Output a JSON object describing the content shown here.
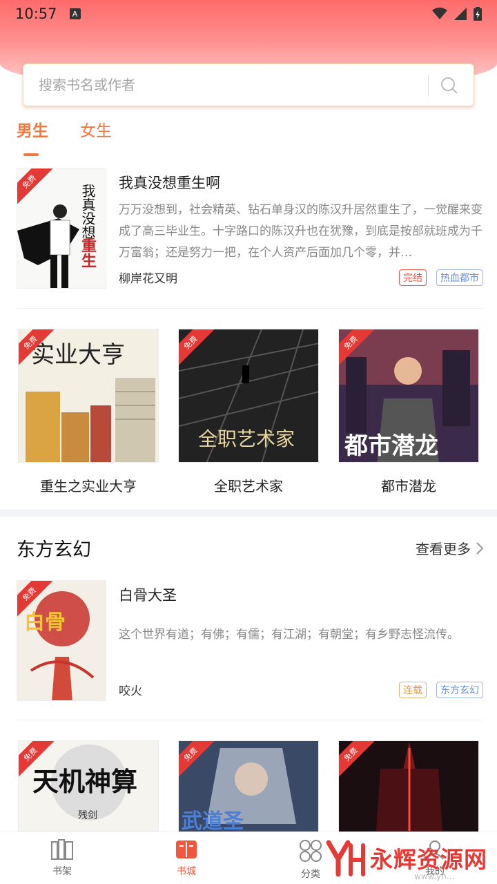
{
  "status": {
    "time": "10:57",
    "notif": "A"
  },
  "search": {
    "placeholder": "搜索书名或作者"
  },
  "gender_tabs": [
    {
      "label": "男生"
    },
    {
      "label": "女生"
    }
  ],
  "ribbon_label": "免费",
  "featured_1": {
    "title": "我真没想重生啊",
    "desc": "万万没想到，社会精英、钻石单身汉的陈汉升居然重生了，一觉醒来变成了高三毕业生。十字路口的陈汉升也在犹豫，到底是按部就班成为千万富翁；还是努力一把，在个人资产后面加几个零，并…",
    "author": "柳岸花又明",
    "tags": [
      {
        "label": "完结",
        "color": "#e8574a"
      },
      {
        "label": "热血都市",
        "color": "#6d8fd8"
      }
    ]
  },
  "grid_1": [
    {
      "title": "重生之实业大亨"
    },
    {
      "title": "全职艺术家"
    },
    {
      "title": "都市潜龙"
    }
  ],
  "section": {
    "title": "东方玄幻",
    "more_label": "查看更多"
  },
  "featured_2": {
    "title": "白骨大圣",
    "desc": "这个世界有道；有佛；有儒；有江湖；有朝堂；有乡野志怪流传。",
    "author": "咬火",
    "tags": [
      {
        "label": "连载",
        "color": "#e89a4a"
      },
      {
        "label": "东方玄幻",
        "color": "#6d8fd8"
      }
    ]
  },
  "nav": [
    {
      "label": "书架",
      "icon": "bookshelf-icon"
    },
    {
      "label": "书城",
      "icon": "book-city-icon"
    },
    {
      "label": "分类",
      "icon": "category-icon"
    },
    {
      "label": "我的",
      "icon": "profile-icon"
    }
  ],
  "watermark": {
    "text": "永辉资源网",
    "url": "www.yh..."
  },
  "colors": {
    "accent": "#f0773f",
    "ribbon": "#e53935",
    "header": "#ff6b6b"
  }
}
